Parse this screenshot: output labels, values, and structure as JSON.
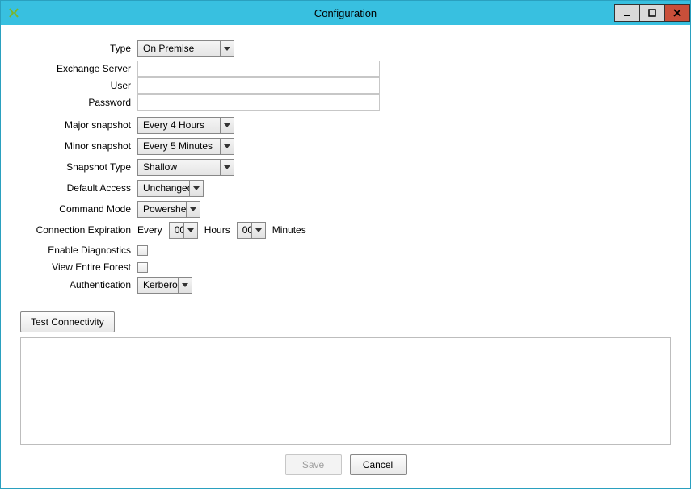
{
  "window": {
    "title": "Configuration"
  },
  "labels": {
    "type": "Type",
    "exchange_server": "Exchange Server",
    "user": "User",
    "password": "Password",
    "major_snapshot": "Major snapshot",
    "minor_snapshot": "Minor snapshot",
    "snapshot_type": "Snapshot Type",
    "default_access": "Default Access",
    "command_mode": "Command Mode",
    "connection_expiration": "Connection Expiration",
    "enable_diagnostics": "Enable Diagnostics",
    "view_entire_forest": "View Entire Forest",
    "authentication": "Authentication",
    "every": "Every",
    "hours": "Hours",
    "minutes": "Minutes"
  },
  "values": {
    "type": "On Premise",
    "exchange_server": "",
    "user": "",
    "password": "",
    "major_snapshot": "Every 4 Hours",
    "minor_snapshot": "Every 5 Minutes",
    "snapshot_type": "Shallow",
    "default_access": "Unchanged",
    "command_mode": "Powershell",
    "expiration_hours": "00",
    "expiration_minutes": "00",
    "authentication": "Kerberos"
  },
  "buttons": {
    "test_connectivity": "Test Connectivity",
    "save": "Save",
    "cancel": "Cancel"
  }
}
